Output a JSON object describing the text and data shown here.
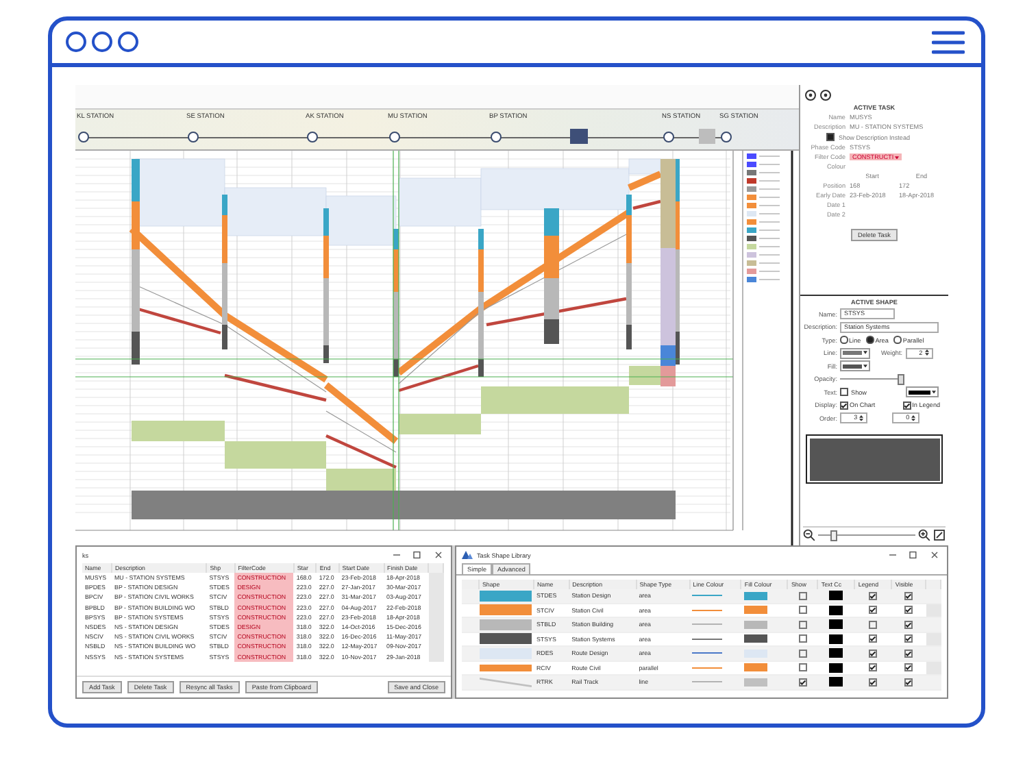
{
  "stations": [
    {
      "name": "KL STATION"
    },
    {
      "name": "SE STATION"
    },
    {
      "name": "AK STATION"
    },
    {
      "name": "MU STATION"
    },
    {
      "name": "BP STATION"
    },
    {
      "name": "NS STATION"
    },
    {
      "name": "SG STATION"
    }
  ],
  "active_task": {
    "title": "ACTIVE TASK",
    "fields": [
      {
        "label": "Name",
        "value": "MUSYS"
      },
      {
        "label": "Description",
        "value": "MU - STATION SYSTEMS"
      }
    ],
    "show_description": {
      "label": "Show Description Instead",
      "checked": true
    },
    "codes": [
      {
        "label": "Phase Code",
        "value": "STSYS",
        "kind": "text"
      },
      {
        "label": "Filter Code",
        "value": "CONSTRUCTI",
        "kind": "dropdown"
      },
      {
        "label": "Colour",
        "kind": "empty"
      }
    ],
    "columns": [
      "Start",
      "End"
    ],
    "rows": [
      {
        "label": "Position",
        "values": [
          "168",
          "172"
        ]
      },
      {
        "label": "Early Date",
        "values": [
          "23-Feb-2018",
          "18-Apr-2018"
        ]
      },
      {
        "label": "Date 1",
        "values": []
      },
      {
        "label": "Date 2",
        "values": []
      }
    ],
    "button": "Delete Task"
  },
  "active_shape": {
    "title": "ACTIVE SHAPE",
    "name_label": "Name:",
    "name": "STSYS",
    "description_label": "Description:",
    "description": "Station Systems",
    "type_label": "Type:",
    "types": [
      {
        "label": "Line",
        "selected": false
      },
      {
        "label": "Area",
        "selected": true
      },
      {
        "label": "Parallel",
        "selected": false
      }
    ],
    "line_label": "Line:",
    "line": {
      "color": "#777777"
    },
    "weight_label": "Weight:",
    "weight": "2",
    "fill_label": "Fill:",
    "fill": {
      "color": "#555555"
    },
    "opacity_label": "Opacity:",
    "opacity": {
      "level": 0.95
    },
    "text_label": "Text:",
    "show": {
      "label": "Show",
      "checked": false
    },
    "text_colour": {
      "color": "#000000"
    },
    "display_label": "Display:",
    "display": [
      {
        "label": "On Chart",
        "checked": true
      },
      {
        "label": "In Legend",
        "checked": true
      }
    ],
    "order_label": "Order:",
    "orders": [
      "3",
      "0"
    ],
    "zoom": {
      "level": 0.12
    }
  },
  "tasks_window": {
    "title": "ks",
    "columns": [
      "Name",
      "Description",
      "Shp",
      "FilterCode",
      "Star",
      "End",
      "Start Date",
      "Finish Date"
    ],
    "rows": [
      [
        "MUSYS",
        "MU - STATION SYSTEMS",
        "STSYS",
        "CONSTRUCTION",
        "168.0",
        "172.0",
        "23-Feb-2018",
        "18-Apr-2018"
      ],
      [
        "BPDES",
        "BP - STATION DESIGN",
        "STDES",
        "DESIGN",
        "223.0",
        "227.0",
        "27-Jan-2017",
        "30-Mar-2017"
      ],
      [
        "BPCIV",
        "BP - STATION CIVIL WORKS",
        "STCIV",
        "CONSTRUCTION",
        "223.0",
        "227.0",
        "31-Mar-2017",
        "03-Aug-2017"
      ],
      [
        "BPBLD",
        "BP - STATION BUILDING WO",
        "STBLD",
        "CONSTRUCTION",
        "223.0",
        "227.0",
        "04-Aug-2017",
        "22-Feb-2018"
      ],
      [
        "BPSYS",
        "BP - STATION SYSTEMS",
        "STSYS",
        "CONSTRUCTION",
        "223.0",
        "227.0",
        "23-Feb-2018",
        "18-Apr-2018"
      ],
      [
        "NSDES",
        "NS - STATION DESIGN",
        "STDES",
        "DESIGN",
        "318.0",
        "322.0",
        "14-Oct-2016",
        "15-Dec-2016"
      ],
      [
        "NSCIV",
        "NS - STATION CIVIL WORKS",
        "STCIV",
        "CONSTRUCTION",
        "318.0",
        "322.0",
        "16-Dec-2016",
        "11-May-2017"
      ],
      [
        "NSBLD",
        "NS - STATION BUILDING WO",
        "STBLD",
        "CONSTRUCTION",
        "318.0",
        "322.0",
        "12-May-2017",
        "09-Nov-2017"
      ],
      [
        "NSSYS",
        "NS - STATION SYSTEMS",
        "STSYS",
        "CONSTRUCTION",
        "318.0",
        "322.0",
        "10-Nov-2017",
        "29-Jan-2018"
      ]
    ],
    "buttons": [
      "Add Task",
      "Delete Task",
      "Resync all Tasks",
      "Paste from Clipboard"
    ],
    "close_button": "Save and Close"
  },
  "shape_library": {
    "title": "Task Shape Library",
    "tabs": [
      {
        "label": "Simple",
        "selected": true
      },
      {
        "label": "Advanced",
        "selected": false
      }
    ],
    "columns": [
      "Shape",
      "Name",
      "Description",
      "Shape Type",
      "Line Colour",
      "Fill Colour",
      "Show",
      "Text Cc",
      "Legend",
      "Visible"
    ],
    "rows": [
      {
        "name": "STDES",
        "description": "Station Design",
        "type": "area",
        "line": {
          "color": "#3aa6c6"
        },
        "color": "#3aa6c6",
        "show": false,
        "legend": true,
        "visible": true
      },
      {
        "name": "STCIV",
        "description": "Station Civil",
        "type": "area",
        "line": {
          "color": "#f28e3a"
        },
        "color": "#f28e3a",
        "show": false,
        "legend": true,
        "visible": true
      },
      {
        "name": "STBLD",
        "description": "Station Building",
        "type": "area",
        "line": {
          "color": "#b3b3b3"
        },
        "color": "#b8b8b8",
        "show": false,
        "legend": false,
        "visible": true
      },
      {
        "name": "STSYS",
        "description": "Station Systems",
        "type": "area",
        "line": {
          "color": "#777777"
        },
        "color": "#555555",
        "show": false,
        "legend": true,
        "visible": true
      },
      {
        "name": "RDES",
        "description": "Route Design",
        "type": "area",
        "line": {
          "color": "#4a78c8"
        },
        "color": "#dde7f3",
        "show": false,
        "legend": true,
        "visible": true
      },
      {
        "name": "RCIV",
        "description": "Route Civil",
        "type": "parallel",
        "line": {
          "color": "#f28e3a"
        },
        "color": "#f28e3a",
        "show": false,
        "legend": true,
        "visible": true
      },
      {
        "name": "RTRK",
        "description": "Rail Track",
        "type": "line",
        "line": {
          "color": "#b3b3b3"
        },
        "color": "#c0c0c0",
        "show": true,
        "legend": true,
        "visible": true
      }
    ]
  }
}
